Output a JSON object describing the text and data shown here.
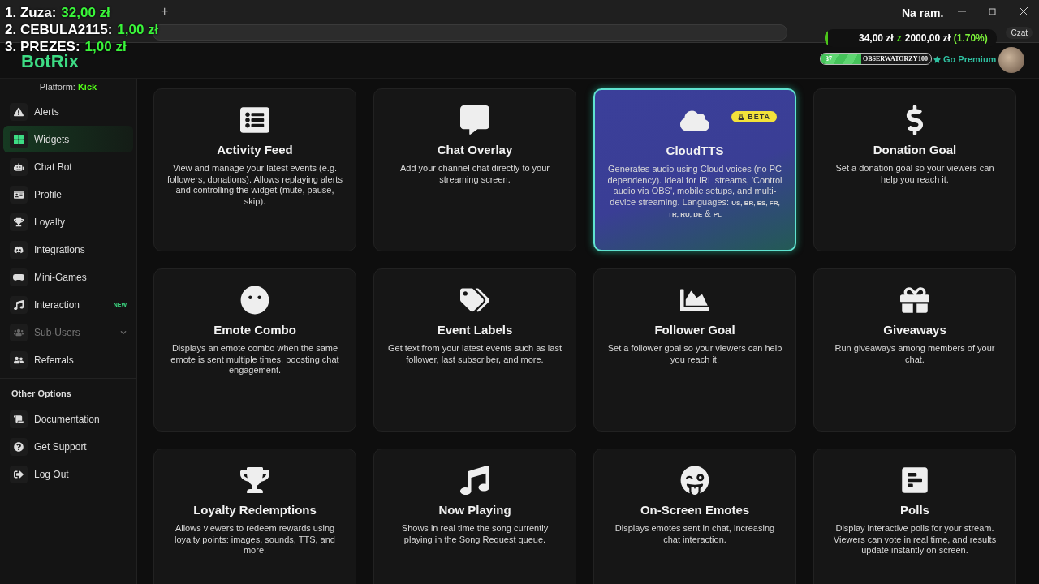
{
  "browser": {
    "new_tab": "+",
    "chat_button": "Czat"
  },
  "overlay": {
    "leaderboard": [
      {
        "rank": "1.",
        "name": "Zuza:",
        "amount": "32,00 zł"
      },
      {
        "rank": "2.",
        "name": "CEBULA2115:",
        "amount": "1,00 zł"
      },
      {
        "rank": "3.",
        "name": "PREZES:",
        "amount": "1,00 zł"
      }
    ],
    "caption": "Na ram.",
    "goal": {
      "current": "34,00 zł",
      "sep": "z",
      "target": "2000,00 zł",
      "percent": "(1.70%)",
      "level": 0.017
    },
    "viewers": {
      "min": "37",
      "label": "OBSERWATORZY",
      "max": "100",
      "level": 0.37
    }
  },
  "header": {
    "logo": "BotRix",
    "premium": "Go Premium"
  },
  "sidebar": {
    "platform_label": "Platform:",
    "platform": "Kick",
    "items": [
      {
        "label": "Alerts",
        "selected": false,
        "disabled": false
      },
      {
        "label": "Widgets",
        "selected": true,
        "disabled": false
      },
      {
        "label": "Chat Bot",
        "selected": false,
        "disabled": false
      },
      {
        "label": "Profile",
        "selected": false,
        "disabled": false
      },
      {
        "label": "Loyalty",
        "selected": false,
        "disabled": false
      },
      {
        "label": "Integrations",
        "selected": false,
        "disabled": false
      },
      {
        "label": "Mini-Games",
        "selected": false,
        "disabled": false
      },
      {
        "label": "Interaction",
        "selected": false,
        "disabled": false,
        "badge": "NEW"
      },
      {
        "label": "Sub-Users",
        "selected": false,
        "disabled": true,
        "expandable": true
      },
      {
        "label": "Referrals",
        "selected": false,
        "disabled": false
      }
    ],
    "section": "Other Options",
    "other": [
      {
        "label": "Documentation",
        "selected": false,
        "disabled": false
      },
      {
        "label": "Get Support",
        "selected": false,
        "disabled": false
      },
      {
        "label": "Log Out",
        "selected": false,
        "disabled": false
      }
    ]
  },
  "widgets": [
    {
      "title": "Activity Feed",
      "description": "View and manage your latest events (e.g. followers, donations). Allows replaying alerts and controlling the widget (mute, pause, skip).",
      "selected": false
    },
    {
      "title": "Chat Overlay",
      "description": "Add your channel chat directly to your streaming screen.",
      "selected": false
    },
    {
      "title": "CloudTTS",
      "description": "Generates audio using Cloud voices (no PC dependency). Ideal for IRL streams, 'Control audio via OBS', mobile setups, and multi-device streaming. Languages: $_{US, BR, ES, FR, TR, RU, DE}$ & $_{PL}$",
      "selected": true,
      "badge": "BETA"
    },
    {
      "title": "Donation Goal",
      "description": "Set a donation goal so your viewers can help you reach it.",
      "selected": false
    },
    {
      "title": "Emote Combo",
      "description": "Displays an emote combo when the same emote is sent multiple times, boosting chat engagement.",
      "selected": false
    },
    {
      "title": "Event Labels",
      "description": "Get text from your latest events such as last follower, last subscriber, and more.",
      "selected": false
    },
    {
      "title": "Follower Goal",
      "description": "Set a follower goal so your viewers can help you reach it.",
      "selected": false
    },
    {
      "title": "Giveaways",
      "description": "Run giveaways among members of your chat.",
      "selected": false
    },
    {
      "title": "Loyalty Redemptions",
      "description": "Allows viewers to redeem rewards using loyalty points: images, sounds, TTS, and more.",
      "selected": false
    },
    {
      "title": "Now Playing",
      "description": "Shows in real time the song currently playing in the Song Request queue.",
      "selected": false
    },
    {
      "title": "On-Screen Emotes",
      "description": "Displays emotes sent in chat, increasing chat interaction.",
      "selected": false
    },
    {
      "title": "Polls",
      "description": "Display interactive polls for your stream. Viewers can vote in real time, and results update instantly on screen.",
      "selected": false
    }
  ]
}
